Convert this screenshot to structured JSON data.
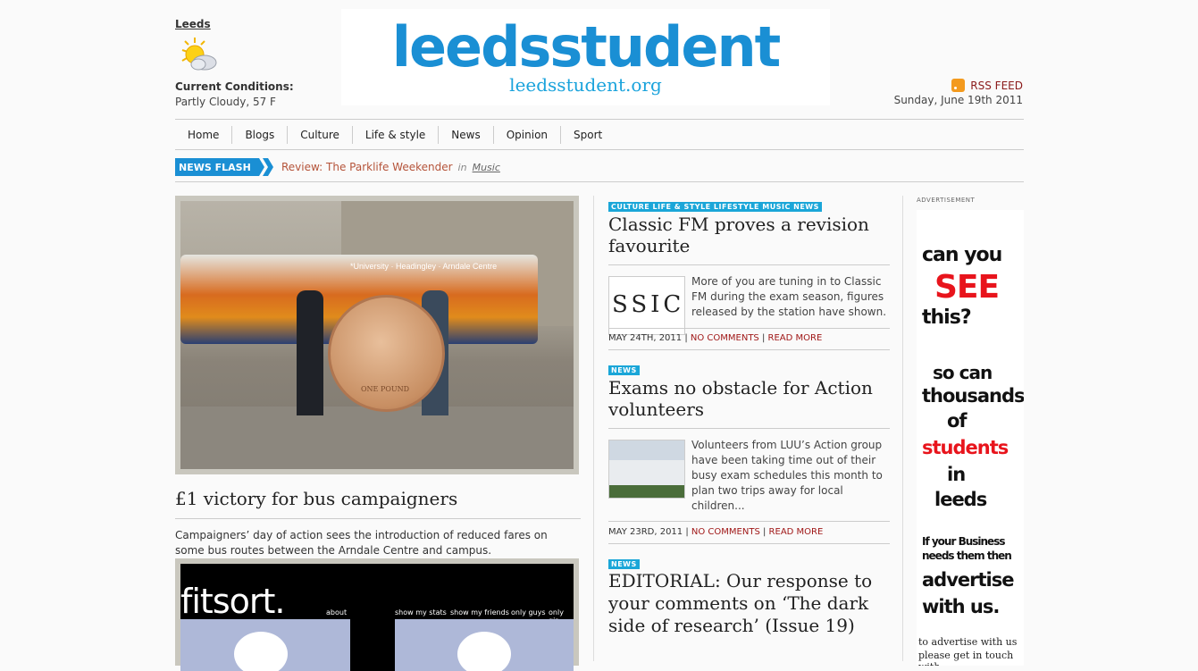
{
  "weather": {
    "city": "Leeds",
    "conditions_label": "Current Conditions:",
    "conditions_value": "Partly Cloudy, 57 F",
    "icon": "partly-cloudy-icon"
  },
  "logo": {
    "main": "leedsstudent",
    "sub": "leedsstudent.org"
  },
  "header": {
    "rss_label": "RSS FEED",
    "date": "Sunday, June 19th 2011"
  },
  "nav": {
    "items": [
      "Home",
      "Blogs",
      "Culture",
      "Life & style",
      "News",
      "Opinion",
      "Sport"
    ]
  },
  "newsflash": {
    "badge": "NEWS FLASH",
    "headline": "Review: The Parklife Weekender",
    "in": "in",
    "category": "Music"
  },
  "feature": {
    "title": "£1 victory for bus campaigners",
    "excerpt": "Campaigners’ day of action sees the introduction of reduced fares on some bus routes between the Arndale Centre and campus.",
    "bus_banner": "*University · Headingley · Arndale Centre",
    "coin_text": "ONE POUND"
  },
  "fitsort": {
    "logo": "fitsort.",
    "menu": [
      "about",
      "show my stats",
      "show my friends",
      "only guys",
      "only gir"
    ]
  },
  "articles": [
    {
      "tags": "CULTURE LIFE & STYLE LIFESTYLE MUSIC NEWS",
      "title": "Classic FM proves a revision favourite",
      "thumb_text": "SSIC",
      "excerpt": "More of you are tuning in to Classic FM during the exam season, figures released by the station have shown.",
      "date": "MAY 24TH, 2011",
      "comments": "NO COMMENTS",
      "read_more": "READ MORE"
    },
    {
      "tags": "NEWS",
      "title": "Exams no obstacle for Action volunteers",
      "excerpt": "Volunteers from LUU’s Action group have been taking time out of their busy exam schedules this month to plan two trips away for local children...",
      "date": "MAY 23RD, 2011",
      "comments": "NO COMMENTS",
      "read_more": "READ MORE"
    },
    {
      "tags": "NEWS",
      "title": "EDITORIAL: Our response to your comments on ‘The dark side of research’ (Issue 19)"
    }
  ],
  "ad": {
    "label": "ADVERTISEMENT",
    "l1": "can you",
    "l2": "SEE",
    "l3": "this?",
    "l4": "so can",
    "l5": "thousands",
    "l6": "of",
    "l7": "students",
    "l8": "in",
    "l9": "leeds",
    "l10": "If your Business",
    "l11": "needs them then",
    "l12": "advertise",
    "l13": "with us.",
    "small1": "to advertise with us",
    "small2": "please get in touch with"
  },
  "colors": {
    "brand_blue": "#1a8fd4",
    "tag_blue": "#1aa6d8",
    "link_red": "#a01818",
    "ad_red": "#e8141c"
  }
}
